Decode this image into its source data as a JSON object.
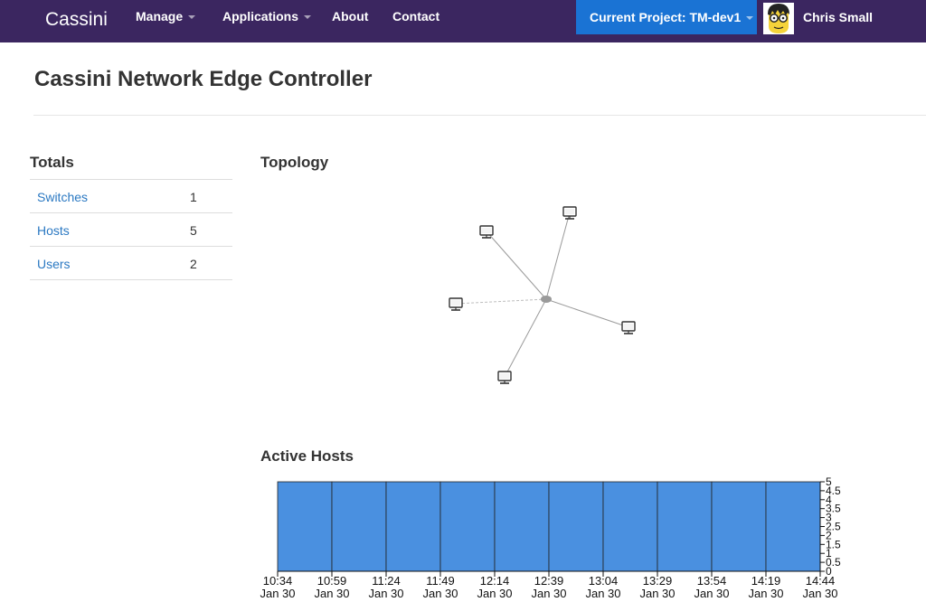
{
  "navbar": {
    "brand": "Cassini",
    "menu": {
      "manage": "Manage",
      "applications": "Applications",
      "about": "About",
      "contact": "Contact"
    },
    "project_button": "Current Project: TM-dev1",
    "user_name": "Chris Small",
    "colors": {
      "background": "#3b2660",
      "project_button": "#1a73d4"
    }
  },
  "page": {
    "title": "Cassini Network Edge Controller"
  },
  "totals": {
    "heading": "Totals",
    "rows": [
      {
        "label": "Switches",
        "value": "1"
      },
      {
        "label": "Hosts",
        "value": "5"
      },
      {
        "label": "Users",
        "value": "2"
      }
    ]
  },
  "topology": {
    "heading": "Topology",
    "switch_count": 1,
    "host_count": 5,
    "icons": {
      "switch": "switch-node-icon",
      "host": "monitor-icon"
    }
  },
  "active_hosts": {
    "heading": "Active Hosts",
    "chart_data": {
      "type": "bar",
      "title": "",
      "xlabel": "",
      "ylabel": "",
      "categories": [
        [
          "10:34",
          "Jan 30"
        ],
        [
          "10:59",
          "Jan 30"
        ],
        [
          "11:24",
          "Jan 30"
        ],
        [
          "11:49",
          "Jan 30"
        ],
        [
          "12:14",
          "Jan 30"
        ],
        [
          "12:39",
          "Jan 30"
        ],
        [
          "13:04",
          "Jan 30"
        ],
        [
          "13:29",
          "Jan 30"
        ],
        [
          "13:54",
          "Jan 30"
        ],
        [
          "14:19",
          "Jan 30"
        ],
        [
          "14:44",
          "Jan 30"
        ]
      ],
      "values": [
        5,
        5,
        5,
        5,
        5,
        5,
        5,
        5,
        5,
        5
      ],
      "ylim": [
        0,
        5
      ],
      "yticks": [
        "0",
        "0.5",
        "1",
        "1.5",
        "2",
        "2.5",
        "3",
        "3.5",
        "4",
        "4.5",
        "5"
      ],
      "y_axis_side": "right",
      "bar_color": "#4a90e0",
      "grid": false
    }
  }
}
